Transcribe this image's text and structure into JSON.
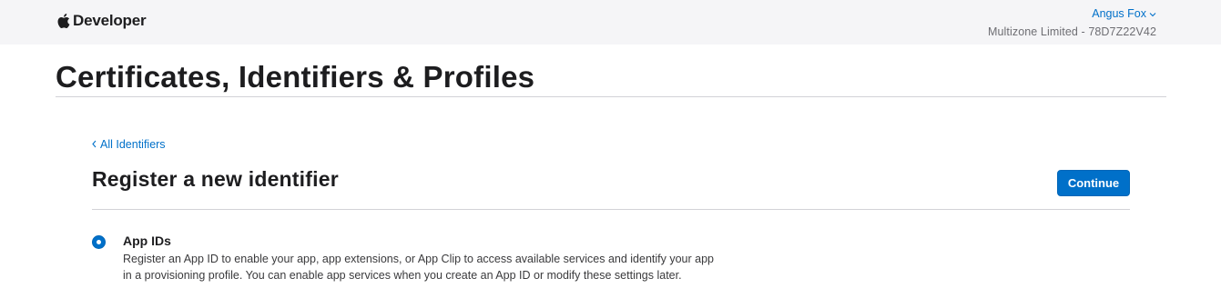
{
  "header": {
    "brand_label": "Developer",
    "logo_icon": "apple-logo-icon",
    "user_name": "Angus Fox",
    "user_menu_icon": "chevron-down-icon",
    "team_label": "Multizone Limited - 78D7Z22V42"
  },
  "page": {
    "title": "Certificates, Identifiers & Profiles"
  },
  "section": {
    "back_link_label": "All Identifiers",
    "back_icon": "chevron-left-icon",
    "title": "Register a new identifier",
    "continue_label": "Continue"
  },
  "options": [
    {
      "title": "App IDs",
      "selected": true,
      "description": "Register an App ID to enable your app, app extensions, or App Clip to access available services and identify your app in a provisioning profile. You can enable app services when you create an App ID or modify these settings later."
    }
  ],
  "colors": {
    "accent": "#0070c9",
    "topbar_bg": "#f5f5f7",
    "divider": "#d2d2d7"
  }
}
